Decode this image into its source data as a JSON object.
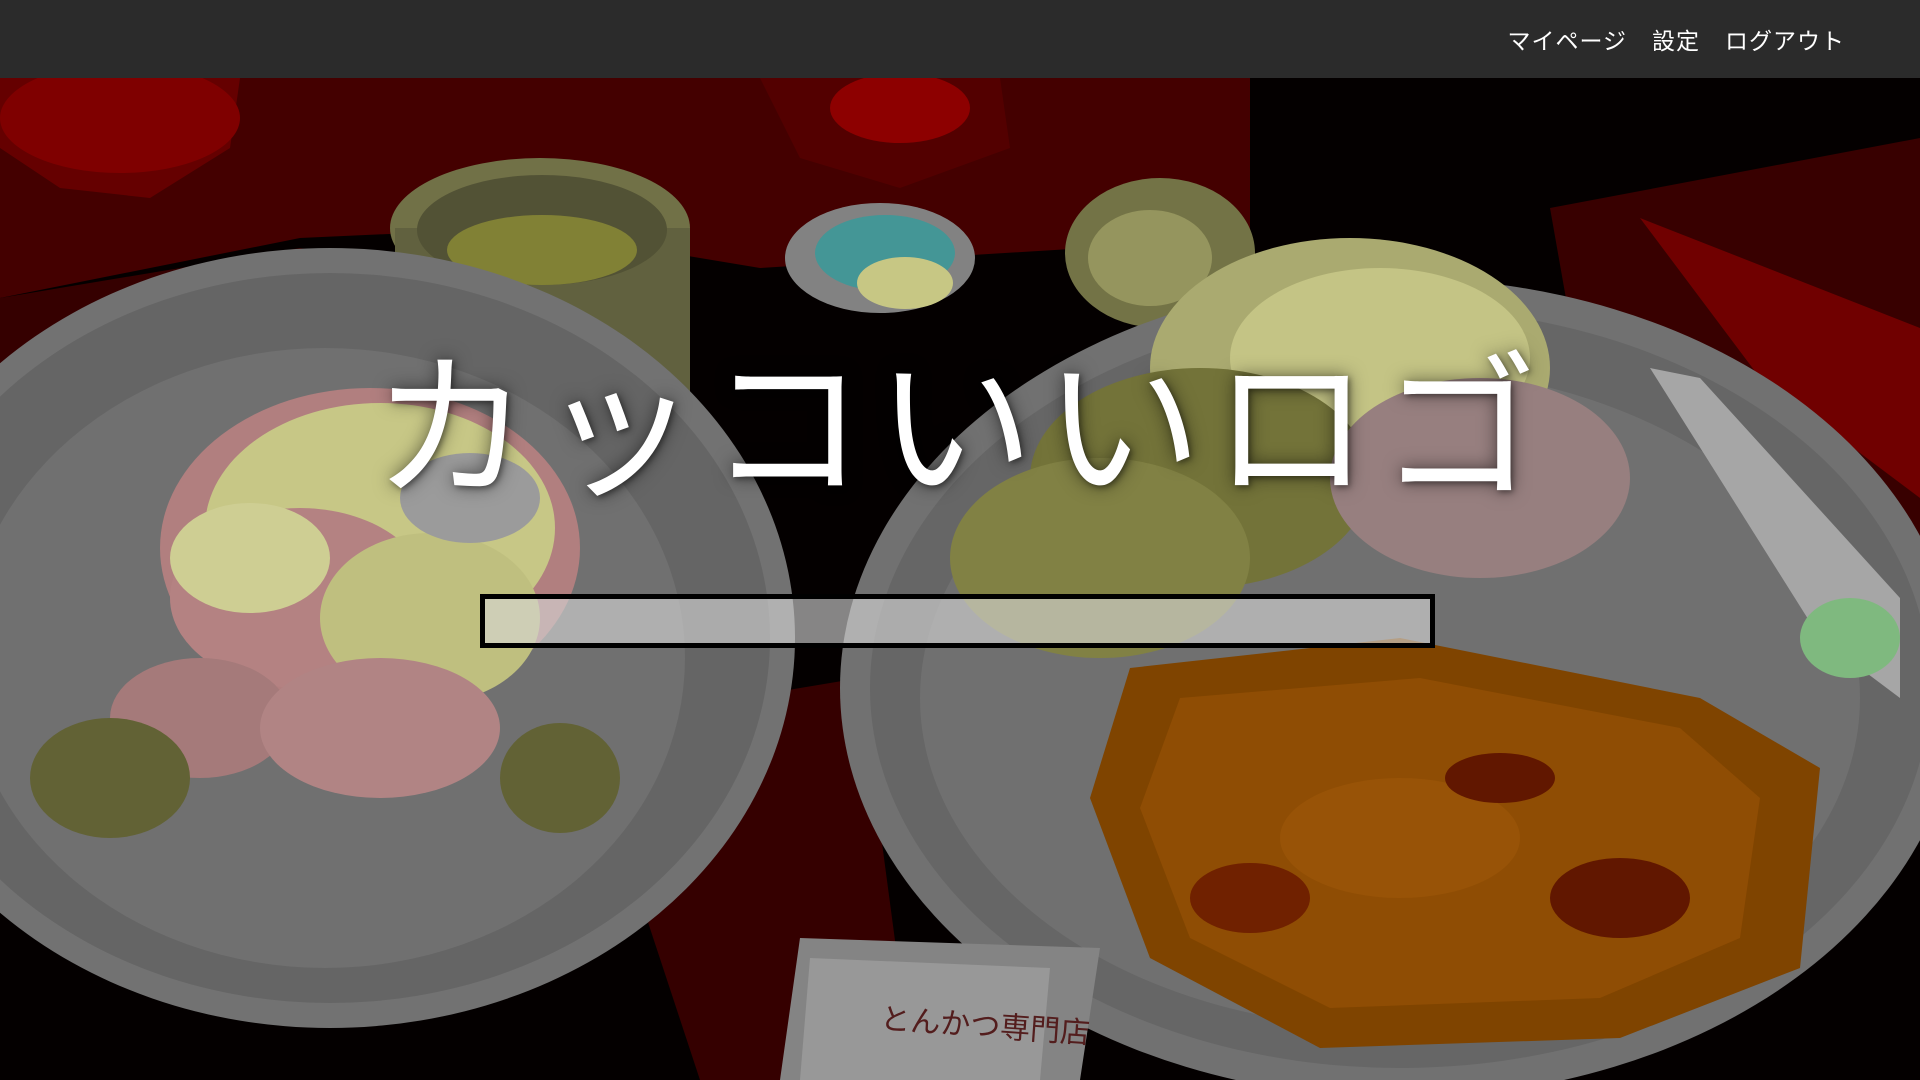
{
  "nav": {
    "mypage": "マイページ",
    "settings": "設定",
    "logout": "ログアウト"
  },
  "hero": {
    "logo": "カッコいいロゴ",
    "search_value": ""
  },
  "background": {
    "sign_text": "とんかつ専門店"
  },
  "colors": {
    "topbar": "#2b2b2b",
    "nav_text": "#ffffff",
    "logo_text": "#ffffff",
    "search_border": "#000000"
  }
}
